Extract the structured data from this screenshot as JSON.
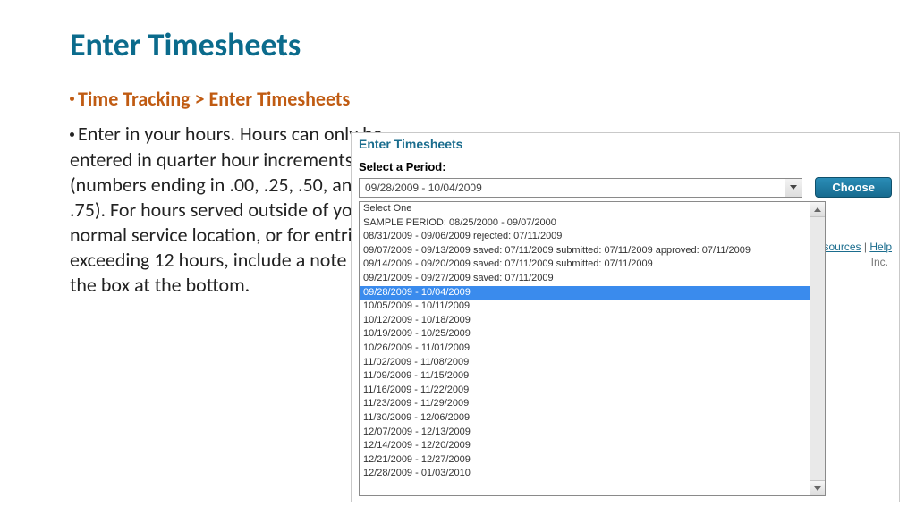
{
  "title": "Enter Timesheets",
  "breadcrumb": "Time Tracking > Enter Timesheets",
  "body": "Enter in your hours. Hours can only be entered in quarter hour increments (numbers ending in .00, .25, .50, and .75). For hours served outside of your normal service location, or for entries exceeding 12 hours, include a note in the box at the bottom.",
  "panel": {
    "heading": "Enter Timesheets",
    "label": "Select a Period:",
    "selected": "09/28/2009 - 10/04/2009",
    "choose": "Choose",
    "bg_link": "esources",
    "bg_help": "Help",
    "bg_inc": "Inc.",
    "options": [
      "Select One",
      "SAMPLE PERIOD: 08/25/2000 - 09/07/2000",
      "08/31/2009 - 09/06/2009 rejected: 07/11/2009",
      "09/07/2009 - 09/13/2009 saved: 07/11/2009 submitted: 07/11/2009 approved: 07/11/2009",
      "09/14/2009 - 09/20/2009 saved: 07/11/2009 submitted: 07/11/2009",
      "09/21/2009 - 09/27/2009 saved: 07/11/2009",
      "09/28/2009 - 10/04/2009",
      "10/05/2009 - 10/11/2009",
      "10/12/2009 - 10/18/2009",
      "10/19/2009 - 10/25/2009",
      "10/26/2009 - 11/01/2009",
      "11/02/2009 - 11/08/2009",
      "11/09/2009 - 11/15/2009",
      "11/16/2009 - 11/22/2009",
      "11/23/2009 - 11/29/2009",
      "11/30/2009 - 12/06/2009",
      "12/07/2009 - 12/13/2009",
      "12/14/2009 - 12/20/2009",
      "12/21/2009 - 12/27/2009",
      "12/28/2009 - 01/03/2010"
    ],
    "selected_index": 6
  }
}
